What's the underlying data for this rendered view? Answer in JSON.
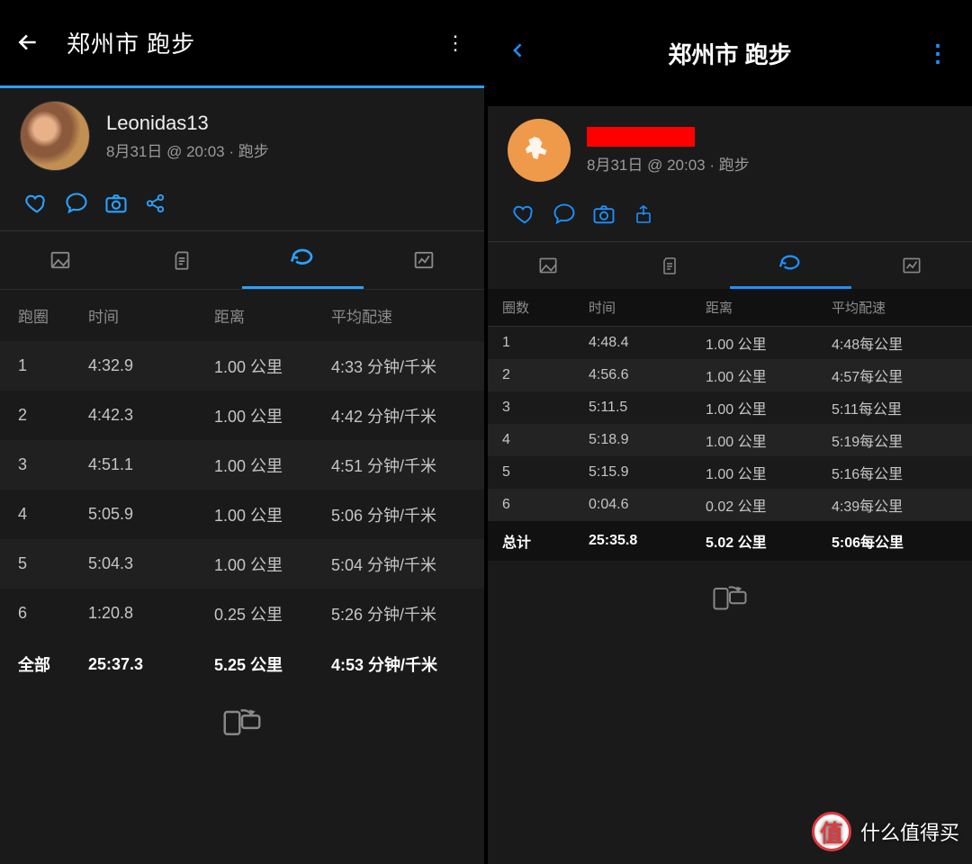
{
  "left": {
    "header": {
      "title": "郑州市 跑步"
    },
    "profile": {
      "name": "Leonidas13",
      "meta": "8月31日 @ 20:03 · 跑步"
    },
    "columns": {
      "lap": "跑圈",
      "time": "时间",
      "dist": "距离",
      "pace": "平均配速"
    },
    "laps": [
      {
        "n": "1",
        "time": "4:32.9",
        "dist": "1.00 公里",
        "pace": "4:33 分钟/千米"
      },
      {
        "n": "2",
        "time": "4:42.3",
        "dist": "1.00 公里",
        "pace": "4:42 分钟/千米"
      },
      {
        "n": "3",
        "time": "4:51.1",
        "dist": "1.00 公里",
        "pace": "4:51 分钟/千米"
      },
      {
        "n": "4",
        "time": "5:05.9",
        "dist": "1.00 公里",
        "pace": "5:06 分钟/千米"
      },
      {
        "n": "5",
        "time": "5:04.3",
        "dist": "1.00 公里",
        "pace": "5:04 分钟/千米"
      },
      {
        "n": "6",
        "time": "1:20.8",
        "dist": "0.25 公里",
        "pace": "5:26 分钟/千米"
      }
    ],
    "total": {
      "label": "全部",
      "time": "25:37.3",
      "dist": "5.25 公里",
      "pace": "4:53 分钟/千米"
    }
  },
  "right": {
    "header": {
      "title": "郑州市 跑步"
    },
    "profile": {
      "meta": "8月31日 @ 20:03 · 跑步"
    },
    "columns": {
      "lap": "圈数",
      "time": "时间",
      "dist": "距离",
      "pace": "平均配速"
    },
    "laps": [
      {
        "n": "1",
        "time": "4:48.4",
        "dist": "1.00 公里",
        "pace": "4:48每公里"
      },
      {
        "n": "2",
        "time": "4:56.6",
        "dist": "1.00 公里",
        "pace": "4:57每公里"
      },
      {
        "n": "3",
        "time": "5:11.5",
        "dist": "1.00 公里",
        "pace": "5:11每公里"
      },
      {
        "n": "4",
        "time": "5:18.9",
        "dist": "1.00 公里",
        "pace": "5:19每公里"
      },
      {
        "n": "5",
        "time": "5:15.9",
        "dist": "1.00 公里",
        "pace": "5:16每公里"
      },
      {
        "n": "6",
        "time": "0:04.6",
        "dist": "0.02 公里",
        "pace": "4:39每公里"
      }
    ],
    "total": {
      "label": "总计",
      "time": "25:35.8",
      "dist": "5.02 公里",
      "pace": "5:06每公里"
    }
  },
  "watermark": {
    "text": "什么值得买"
  }
}
